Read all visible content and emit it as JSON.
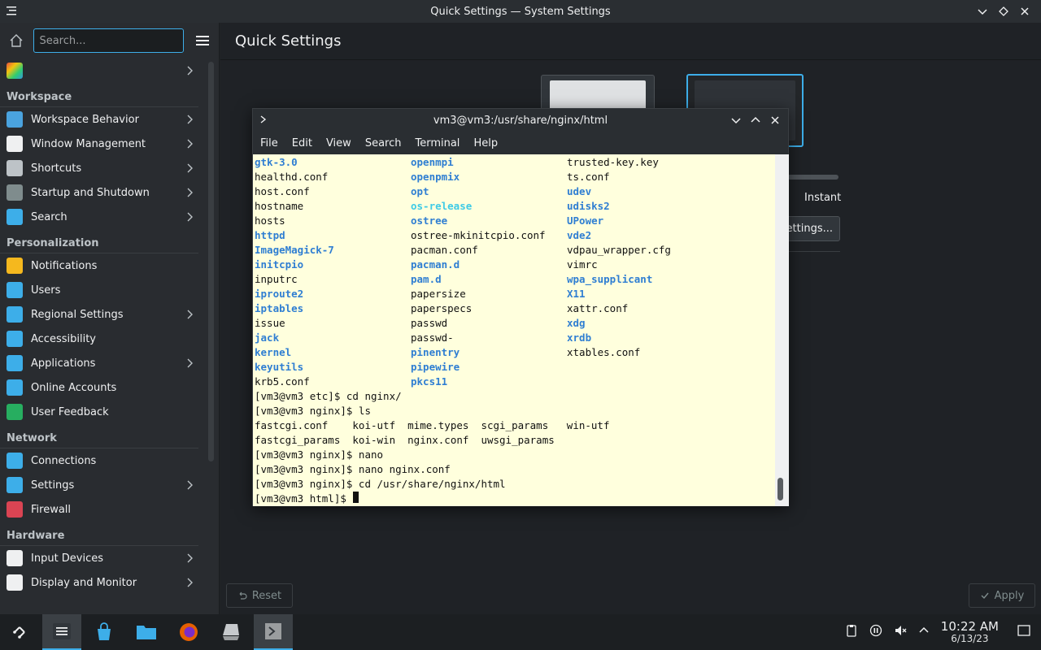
{
  "window": {
    "title": "Quick Settings — System Settings"
  },
  "sidebar": {
    "search_placeholder": "Search...",
    "top_item": "",
    "sections": [
      {
        "title": "Workspace",
        "items": [
          {
            "label": "Workspace Behavior",
            "icon": "workspace-behavior-icon",
            "color": "#4aa3df",
            "has_arrow": true
          },
          {
            "label": "Window Management",
            "icon": "window-management-icon",
            "color": "#eff0f1",
            "has_arrow": true
          },
          {
            "label": "Shortcuts",
            "icon": "keyboard-icon",
            "color": "#bdc3c7",
            "has_arrow": true
          },
          {
            "label": "Startup and Shutdown",
            "icon": "startup-icon",
            "color": "#7f8c8d",
            "has_arrow": true
          },
          {
            "label": "Search",
            "icon": "search-icon",
            "color": "#3daee9",
            "has_arrow": true
          }
        ]
      },
      {
        "title": "Personalization",
        "items": [
          {
            "label": "Notifications",
            "icon": "bell-icon",
            "color": "#f5b81e",
            "has_arrow": false
          },
          {
            "label": "Users",
            "icon": "users-icon",
            "color": "#3daee9",
            "has_arrow": false
          },
          {
            "label": "Regional Settings",
            "icon": "regional-icon",
            "color": "#3daee9",
            "has_arrow": true
          },
          {
            "label": "Accessibility",
            "icon": "accessibility-icon",
            "color": "#3daee9",
            "has_arrow": false
          },
          {
            "label": "Applications",
            "icon": "applications-icon",
            "color": "#3daee9",
            "has_arrow": true
          },
          {
            "label": "Online Accounts",
            "icon": "online-accounts-icon",
            "color": "#3daee9",
            "has_arrow": false
          },
          {
            "label": "User Feedback",
            "icon": "feedback-icon",
            "color": "#27ae60",
            "has_arrow": false
          }
        ]
      },
      {
        "title": "Network",
        "items": [
          {
            "label": "Connections",
            "icon": "globe-icon",
            "color": "#3daee9",
            "has_arrow": false
          },
          {
            "label": "Settings",
            "icon": "network-settings-icon",
            "color": "#3daee9",
            "has_arrow": true
          },
          {
            "label": "Firewall",
            "icon": "firewall-icon",
            "color": "#da4453",
            "has_arrow": false
          }
        ]
      },
      {
        "title": "Hardware",
        "items": [
          {
            "label": "Input Devices",
            "icon": "mouse-icon",
            "color": "#eff0f1",
            "has_arrow": true
          },
          {
            "label": "Display and Monitor",
            "icon": "monitor-icon",
            "color": "#eff0f1",
            "has_arrow": true
          }
        ]
      }
    ]
  },
  "main": {
    "title": "Quick Settings",
    "instant_label": "Instant",
    "settings_button": "Settings...",
    "reset_button": "Reset",
    "apply_button": "Apply"
  },
  "terminal": {
    "title": "vm3@vm3:/usr/share/nginx/html",
    "menu": [
      "File",
      "Edit",
      "View",
      "Search",
      "Terminal",
      "Help"
    ],
    "listing": [
      [
        {
          "t": "gtk-3.0",
          "k": "dir"
        },
        {
          "t": "openmpi",
          "k": "dir"
        },
        {
          "t": "trusted-key.key",
          "k": "plain"
        }
      ],
      [
        {
          "t": "healthd.conf",
          "k": "plain"
        },
        {
          "t": "openpmix",
          "k": "dir"
        },
        {
          "t": "ts.conf",
          "k": "plain"
        }
      ],
      [
        {
          "t": "host.conf",
          "k": "plain"
        },
        {
          "t": "opt",
          "k": "dir"
        },
        {
          "t": "udev",
          "k": "dir"
        }
      ],
      [
        {
          "t": "hostname",
          "k": "plain"
        },
        {
          "t": "os-release",
          "k": "bright"
        },
        {
          "t": "udisks2",
          "k": "dir"
        }
      ],
      [
        {
          "t": "hosts",
          "k": "plain"
        },
        {
          "t": "ostree",
          "k": "dir"
        },
        {
          "t": "UPower",
          "k": "dir"
        }
      ],
      [
        {
          "t": "httpd",
          "k": "dir"
        },
        {
          "t": "ostree-mkinitcpio.conf",
          "k": "plain"
        },
        {
          "t": "vde2",
          "k": "dir"
        }
      ],
      [
        {
          "t": "ImageMagick-7",
          "k": "dir"
        },
        {
          "t": "pacman.conf",
          "k": "plain"
        },
        {
          "t": "vdpau_wrapper.cfg",
          "k": "plain"
        }
      ],
      [
        {
          "t": "initcpio",
          "k": "dir"
        },
        {
          "t": "pacman.d",
          "k": "dir"
        },
        {
          "t": "vimrc",
          "k": "plain"
        }
      ],
      [
        {
          "t": "inputrc",
          "k": "plain"
        },
        {
          "t": "pam.d",
          "k": "dir"
        },
        {
          "t": "wpa_supplicant",
          "k": "dir"
        }
      ],
      [
        {
          "t": "iproute2",
          "k": "dir"
        },
        {
          "t": "papersize",
          "k": "plain"
        },
        {
          "t": "X11",
          "k": "dir"
        }
      ],
      [
        {
          "t": "iptables",
          "k": "dir"
        },
        {
          "t": "paperspecs",
          "k": "plain"
        },
        {
          "t": "xattr.conf",
          "k": "plain"
        }
      ],
      [
        {
          "t": "issue",
          "k": "plain"
        },
        {
          "t": "passwd",
          "k": "plain"
        },
        {
          "t": "xdg",
          "k": "dir"
        }
      ],
      [
        {
          "t": "jack",
          "k": "dir"
        },
        {
          "t": "passwd-",
          "k": "plain"
        },
        {
          "t": "xrdb",
          "k": "dir"
        }
      ],
      [
        {
          "t": "kernel",
          "k": "dir"
        },
        {
          "t": "pinentry",
          "k": "dir"
        },
        {
          "t": "xtables.conf",
          "k": "plain"
        }
      ],
      [
        {
          "t": "keyutils",
          "k": "dir"
        },
        {
          "t": "pipewire",
          "k": "dir"
        },
        {
          "t": "",
          "k": "plain"
        }
      ],
      [
        {
          "t": "krb5.conf",
          "k": "plain"
        },
        {
          "t": "pkcs11",
          "k": "dir"
        },
        {
          "t": "",
          "k": "plain"
        }
      ]
    ],
    "lines": [
      "[vm3@vm3 etc]$ cd nginx/",
      "[vm3@vm3 nginx]$ ls",
      "fastcgi.conf    koi-utf  mime.types  scgi_params   win-utf",
      "fastcgi_params  koi-win  nginx.conf  uwsgi_params",
      "[vm3@vm3 nginx]$ nano",
      "[vm3@vm3 nginx]$ nano nginx.conf",
      "[vm3@vm3 nginx]$ cd /usr/share/nginx/html"
    ],
    "prompt": "[vm3@vm3 html]$ "
  },
  "taskbar": {
    "apps": [
      {
        "name": "app-launcher-icon",
        "active": false
      },
      {
        "name": "system-settings-icon",
        "active": true
      },
      {
        "name": "discover-icon",
        "active": false
      },
      {
        "name": "file-manager-icon",
        "active": false
      },
      {
        "name": "firefox-icon",
        "active": false
      },
      {
        "name": "scanner-icon",
        "active": false
      },
      {
        "name": "terminal-icon",
        "active": true
      }
    ],
    "time": "10:22 AM",
    "date": "6/13/23"
  }
}
